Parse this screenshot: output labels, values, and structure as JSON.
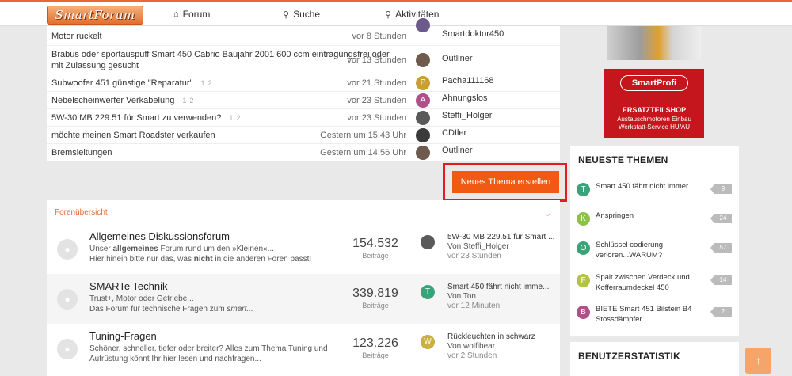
{
  "header": {
    "logo_text": "SmartForum",
    "nav": [
      {
        "label": "Forum",
        "icon": "home-icon"
      },
      {
        "label": "Suche",
        "icon": "search-icon"
      },
      {
        "label": "Aktivitäten",
        "icon": "bulb-icon"
      }
    ]
  },
  "threads": [
    {
      "title": "Motor ruckelt",
      "title2": "",
      "pages": [],
      "time": "vor 8 Stunden",
      "user": "Smartdoktor450",
      "avatar_color": "#6b5a8a"
    },
    {
      "title": "Brabus oder sportauspuff Smart 450 Cabrio Baujahr 2001 600 ccm eintragungsfrei oder",
      "title2": "mit Zulassung gesucht",
      "pages": [],
      "time": "vor 13 Stunden",
      "user": "Outliner",
      "avatar_color": "#6e5b4d"
    },
    {
      "title": "Subwoofer 451 günstige \"Reparatur\"",
      "title2": "",
      "pages": [
        "1",
        "2"
      ],
      "time": "vor 21 Stunden",
      "user": "Pacha111168",
      "avatar_color": "#c9a030",
      "avatar_letter": "P"
    },
    {
      "title": "Nebelscheinwerfer Verkabelung",
      "title2": "",
      "pages": [
        "1",
        "2"
      ],
      "time": "vor 23 Stunden",
      "user": "Ahnungslos",
      "avatar_color": "#b0508a",
      "avatar_letter": "A"
    },
    {
      "title": "5W-30 MB 229.51 für Smart zu verwenden?",
      "title2": "",
      "pages": [
        "1",
        "2"
      ],
      "time": "vor 23 Stunden",
      "user": "Steffi_Holger",
      "avatar_color": "#5a5a5a"
    },
    {
      "title": "möchte meinen Smart Roadster verkaufen",
      "title2": "",
      "pages": [],
      "time": "Gestern um 15:43 Uhr",
      "user": "CDIler",
      "avatar_color": "#3a3a3a"
    },
    {
      "title": "Bremsleitungen",
      "title2": "",
      "pages": [],
      "time": "Gestern um 14:56 Uhr",
      "user": "Outliner",
      "avatar_color": "#6e5b4d"
    }
  ],
  "new_thread_button": "Neues Thema erstellen",
  "forum_overview": {
    "heading": "Forenübersicht",
    "forums": [
      {
        "name": "Allgemeines Diskussionsforum",
        "desc1_pre": "Unser ",
        "desc1_bold": "allgemeines",
        "desc1_post": " Forum rund um den »Kleinen«...",
        "desc2_pre": "Hier hinein bitte nur das, was ",
        "desc2_bold": "nicht",
        "desc2_post": " in die anderen Foren passt!",
        "posts": "154.532",
        "posts_label": "Beiträge",
        "last_title": "5W-30 MB 229.51 für Smart ...",
        "last_by": "Von Steffi_Holger",
        "last_time": "vor 23 Stunden",
        "avatar_color": "#5a5a5a",
        "avatar_letter": ""
      },
      {
        "name": "SMARTe Technik",
        "desc1_pre": "Trust+, Motor oder Getriebe...",
        "desc1_bold": "",
        "desc1_post": "",
        "desc2_pre": "Das Forum für technische Fragen zum ",
        "desc2_bold": "",
        "desc2_post": "smart...",
        "posts": "339.819",
        "posts_label": "Beiträge",
        "last_title": "Smart 450 fährt nicht imme...",
        "last_by": "Von Ton",
        "last_time": "vor 12 Minuten",
        "avatar_color": "#3aa37a",
        "avatar_letter": "T"
      },
      {
        "name": "Tuning-Fragen",
        "desc1_pre": "Schöner, schneller, tiefer oder breiter? Alles zum Thema Tuning und",
        "desc1_bold": "",
        "desc1_post": "",
        "desc2_pre": "Aufrüstung könnt Ihr hier lesen und nachfragen...",
        "desc2_bold": "",
        "desc2_post": "",
        "posts": "123.226",
        "posts_label": "Beiträge",
        "last_title": "Rückleuchten in schwarz",
        "last_by": "Von wolfibear",
        "last_time": "vor 2 Stunden",
        "avatar_color": "#c9b040",
        "avatar_letter": "W"
      }
    ]
  },
  "sidebar": {
    "ad": {
      "brand": "SmartProfi",
      "shop": "ERSATZTEILSHOP",
      "line1": "Austauschmotoren Einbau",
      "line2": "Werkstatt-Service HU/AU"
    },
    "newest_title": "NEUESTE THEMEN",
    "newest": [
      {
        "letter": "T",
        "color": "#3aa37a",
        "text": "Smart 450 fährt nicht immer",
        "count": "9"
      },
      {
        "letter": "K",
        "color": "#8bc34a",
        "text": "Anspringen",
        "count": "24"
      },
      {
        "letter": "O",
        "color": "#3aa37a",
        "text": "Schlüssel codierung verloren...WARUM?",
        "count": "57"
      },
      {
        "letter": "F",
        "color": "#b4c440",
        "text": "Spalt zwischen Verdeck und Kofferraumdeckel 450",
        "count": "14"
      },
      {
        "letter": "B",
        "color": "#b0508a",
        "text": "BIETE Smart 451 Bilstein B4 Stossdämpfer",
        "count": "2"
      }
    ],
    "stats_title": "BENUTZERSTATISTIK"
  },
  "scroll_top_icon": "arrow-up-icon"
}
